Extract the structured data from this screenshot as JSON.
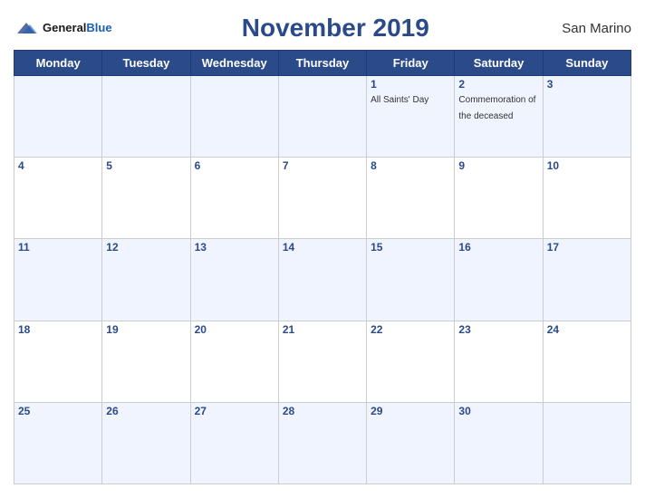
{
  "header": {
    "logo_general": "General",
    "logo_blue": "Blue",
    "title": "November 2019",
    "country": "San Marino"
  },
  "weekdays": [
    "Monday",
    "Tuesday",
    "Wednesday",
    "Thursday",
    "Friday",
    "Saturday",
    "Sunday"
  ],
  "weeks": [
    [
      {
        "day": null
      },
      {
        "day": null
      },
      {
        "day": null
      },
      {
        "day": null
      },
      {
        "day": 1,
        "holiday": "All Saints' Day"
      },
      {
        "day": 2,
        "holiday": "Commemoration of the deceased"
      },
      {
        "day": 3
      }
    ],
    [
      {
        "day": 4
      },
      {
        "day": 5
      },
      {
        "day": 6
      },
      {
        "day": 7
      },
      {
        "day": 8
      },
      {
        "day": 9
      },
      {
        "day": 10
      }
    ],
    [
      {
        "day": 11
      },
      {
        "day": 12
      },
      {
        "day": 13
      },
      {
        "day": 14
      },
      {
        "day": 15
      },
      {
        "day": 16
      },
      {
        "day": 17
      }
    ],
    [
      {
        "day": 18
      },
      {
        "day": 19
      },
      {
        "day": 20
      },
      {
        "day": 21
      },
      {
        "day": 22
      },
      {
        "day": 23
      },
      {
        "day": 24
      }
    ],
    [
      {
        "day": 25
      },
      {
        "day": 26
      },
      {
        "day": 27
      },
      {
        "day": 28
      },
      {
        "day": 29
      },
      {
        "day": 30
      },
      {
        "day": null
      }
    ]
  ]
}
